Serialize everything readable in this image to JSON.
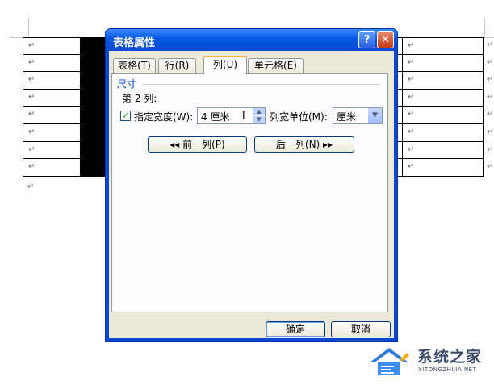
{
  "document": {
    "paragraph_mark": "↵",
    "rows": 8
  },
  "dialog": {
    "title": "表格属性",
    "help_glyph": "?",
    "close_glyph": "✕",
    "tabs": [
      {
        "label": "表格(T)",
        "active": false
      },
      {
        "label": "行(R)",
        "active": false
      },
      {
        "label": "列(U)",
        "active": true
      },
      {
        "label": "单元格(E)",
        "active": false
      }
    ],
    "size_group": {
      "label": "尺寸",
      "column_label": "第 2 列:",
      "specify_width": {
        "label": "指定宽度(W):",
        "checked": true,
        "check_glyph": "✓",
        "value": "4 厘米"
      },
      "width_unit": {
        "label": "列宽单位(M):",
        "value": "厘米"
      }
    },
    "nav": {
      "prev_label": "◂◂ 前一列(P)",
      "next_label": "后一列(N) ▸▸"
    },
    "ok_label": "确定",
    "cancel_label": "取消"
  },
  "watermark": {
    "name": "系统之家",
    "url": "XITONGZHIJIA.NET"
  },
  "colors": {
    "title_bar": "#0a5ae3",
    "dialog_face": "#ece9d8",
    "group_label": "#0046d5",
    "active_tab_accent": "#f9b53b"
  }
}
